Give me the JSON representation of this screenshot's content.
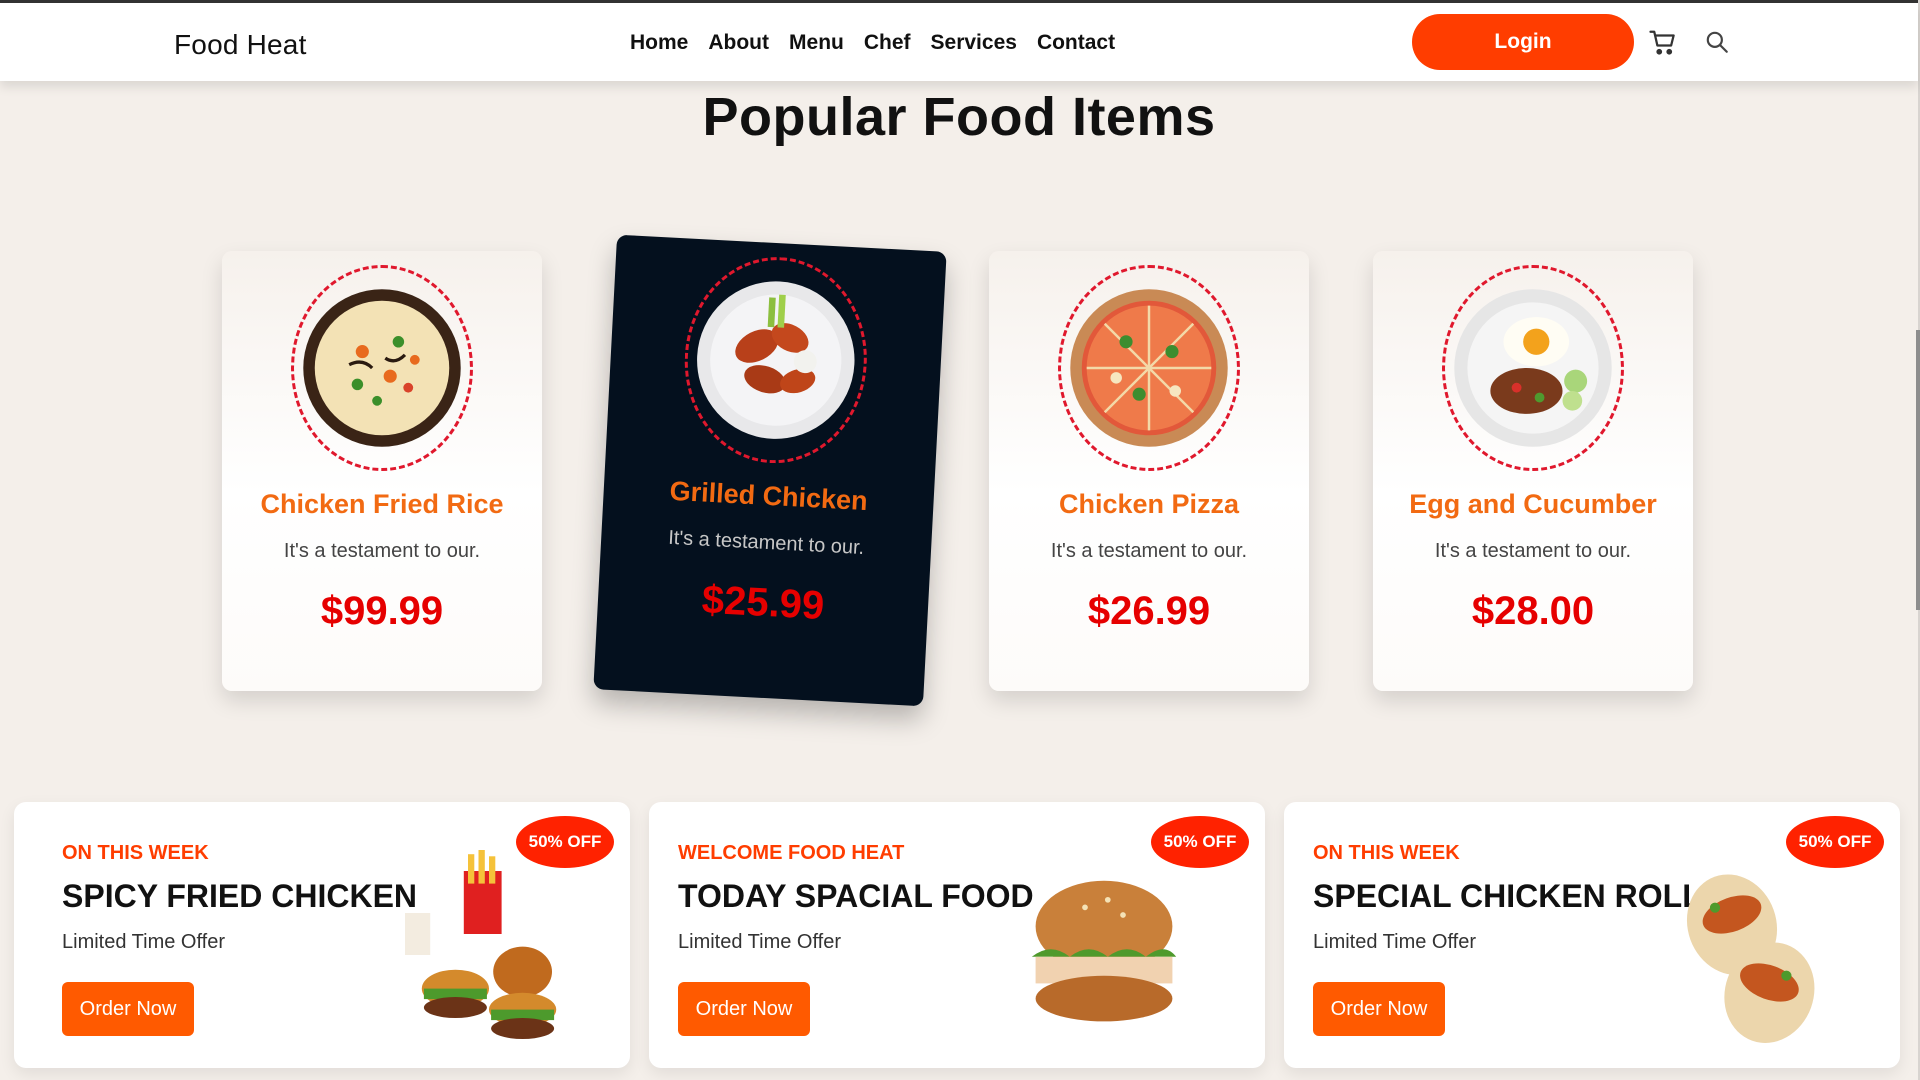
{
  "header": {
    "brand": "Food Heat",
    "nav": [
      "Home",
      "About",
      "Menu",
      "Chef",
      "Services",
      "Contact"
    ],
    "login_label": "Login"
  },
  "popular": {
    "title": "Popular Food Items",
    "items": [
      {
        "name": "Chicken Fried Rice",
        "desc": "It's a testament to our.",
        "price": "$99.99",
        "featured": false
      },
      {
        "name": "Grilled Chicken",
        "desc": "It's a testament to our.",
        "price": "$25.99",
        "featured": true
      },
      {
        "name": "Chicken Pizza",
        "desc": "It's a testament to our.",
        "price": "$26.99",
        "featured": false
      },
      {
        "name": "Egg and Cucumber",
        "desc": "It's a testament to our.",
        "price": "$28.00",
        "featured": false
      }
    ]
  },
  "offers": [
    {
      "kicker": "ON THIS WEEK",
      "title": "SPICY FRIED CHICKEN",
      "subtitle": "Limited Time Offer",
      "button": "Order Now",
      "badge": "50% OFF"
    },
    {
      "kicker": "WELCOME FOOD HEAT",
      "title": "TODAY SPACIAL FOOD",
      "subtitle": "Limited Time Offer",
      "button": "Order Now",
      "badge": "50% OFF"
    },
    {
      "kicker": "ON THIS WEEK",
      "title": "SPECIAL CHICKEN ROLL",
      "subtitle": "Limited Time Offer",
      "button": "Order Now",
      "badge": "50% OFF"
    }
  ],
  "colors": {
    "accent": "#ff3d00",
    "price": "#e60000",
    "food_name": "#f26a12",
    "featured_card": "#04101e",
    "page_bg": "#f4efea"
  },
  "icons": {
    "cart": "cart-icon",
    "search": "search-icon"
  }
}
